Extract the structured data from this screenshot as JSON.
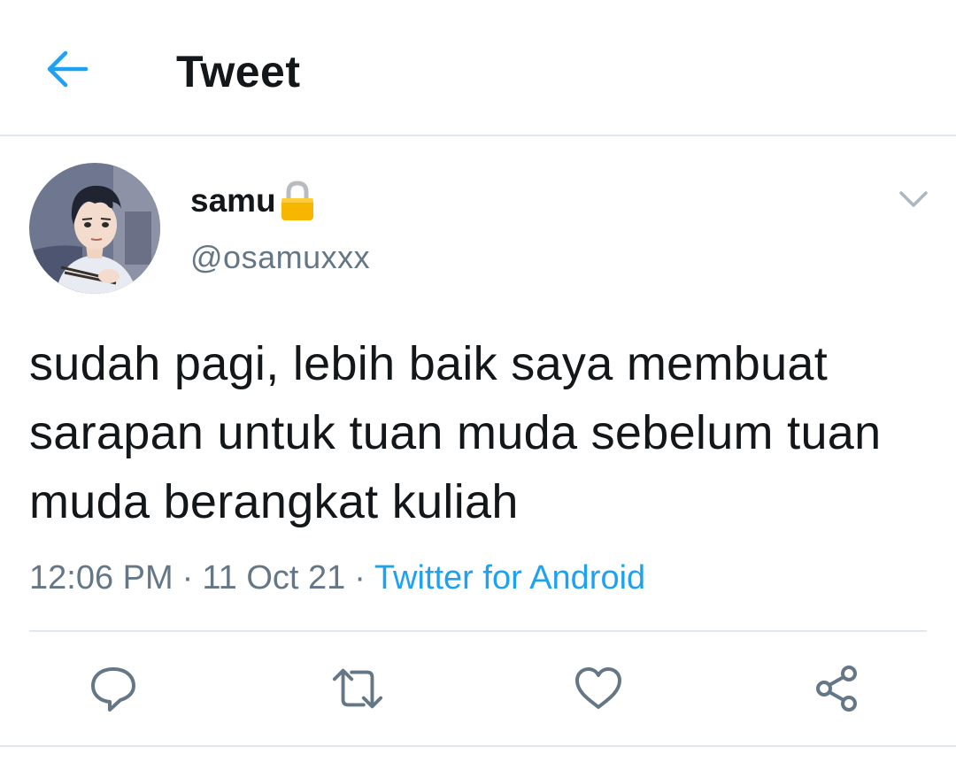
{
  "header": {
    "title": "Tweet",
    "back_icon": "arrow-left-icon",
    "accent": "#1da1f2"
  },
  "author": {
    "display_name": "samu",
    "lock_icon": "lock-icon",
    "handle": "@osamuxxx"
  },
  "tweet": {
    "text": "sudah pagi, lebih baik saya membuat sarapan untuk tuan muda sebelum tuan muda berangkat kuliah",
    "time": "12:06 PM",
    "separator": "·",
    "date": "11 Oct 21",
    "source": "Twitter for Android"
  },
  "actions": {
    "reply": "reply-icon",
    "retweet": "retweet-icon",
    "like": "heart-icon",
    "share": "share-icon"
  },
  "colors": {
    "text": "#14171a",
    "muted": "#657786",
    "link": "#1da1f2",
    "border": "#e1e8ed"
  }
}
